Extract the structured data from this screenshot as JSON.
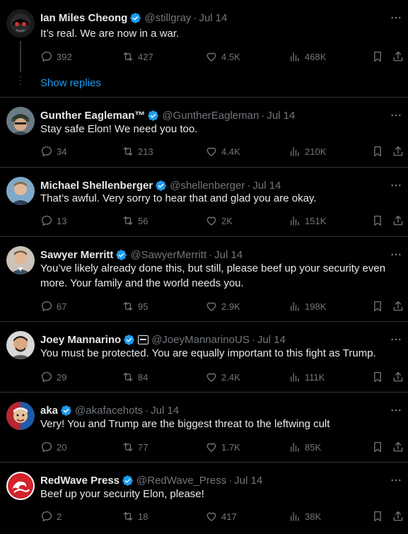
{
  "theme": {
    "background": "#000000",
    "text": "#e7e9ea",
    "muted": "#71767b",
    "accent": "#1d9bf0",
    "border": "#2f3336"
  },
  "show_replies_label": "Show replies",
  "tweets": [
    {
      "name": "Ian Miles Cheong",
      "handle": "@stillgray",
      "time": "Jul 14",
      "text": "It’s real. We are now in a war.",
      "replies": "392",
      "reposts": "427",
      "likes": "4.5K",
      "views": "468K",
      "avatar": "avatar-ian"
    },
    {
      "name": "Gunther Eagleman™",
      "handle": "@GuntherEagleman",
      "time": "Jul 14",
      "text": "Stay safe Elon!  We need you too.",
      "replies": "34",
      "reposts": "213",
      "likes": "4.4K",
      "views": "210K",
      "avatar": "avatar-gunther"
    },
    {
      "name": "Michael Shellenberger",
      "handle": "@shellenberger",
      "time": "Jul 14",
      "text": "That’s awful. Very sorry to hear that and glad you are okay.",
      "replies": "13",
      "reposts": "56",
      "likes": "2K",
      "views": "151K",
      "avatar": "avatar-michael"
    },
    {
      "name": "Sawyer Merritt",
      "handle": "@SawyerMerritt",
      "time": "Jul 14",
      "text": "You’ve likely already done this, but still, please beef up your security even more. Your family and the world needs you.",
      "replies": "67",
      "reposts": "95",
      "likes": "2.9K",
      "views": "198K",
      "avatar": "avatar-sawyer"
    },
    {
      "name": "Joey Mannarino",
      "handle": "@JoeyMannarinoUS",
      "time": "Jul 14",
      "text": "You must be protected. You are equally important to this fight as Trump.",
      "replies": "29",
      "reposts": "84",
      "likes": "2.4K",
      "views": "111K",
      "avatar": "avatar-joey"
    },
    {
      "name": "aka",
      "handle": "@akafacehots",
      "time": "Jul 14",
      "text": "Very! You and Trump are the biggest threat to the leftwing cult",
      "replies": "20",
      "reposts": "77",
      "likes": "1.7K",
      "views": "85K",
      "avatar": "avatar-aka"
    },
    {
      "name": "RedWave Press",
      "handle": "@RedWave_Press",
      "time": "Jul 14",
      "text": "Beef up your security Elon, please!",
      "replies": "2",
      "reposts": "18",
      "likes": "417",
      "views": "38K",
      "avatar": "avatar-redwave"
    }
  ]
}
